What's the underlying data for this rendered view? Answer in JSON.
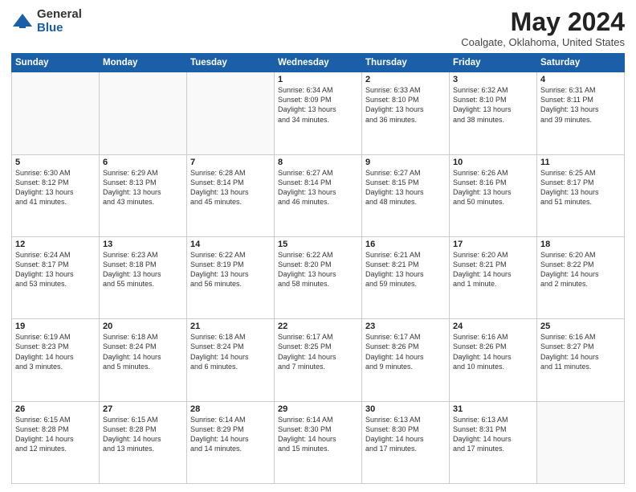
{
  "header": {
    "logo_general": "General",
    "logo_blue": "Blue",
    "title": "May 2024",
    "location": "Coalgate, Oklahoma, United States"
  },
  "days_of_week": [
    "Sunday",
    "Monday",
    "Tuesday",
    "Wednesday",
    "Thursday",
    "Friday",
    "Saturday"
  ],
  "weeks": [
    [
      {
        "day": "",
        "info": ""
      },
      {
        "day": "",
        "info": ""
      },
      {
        "day": "",
        "info": ""
      },
      {
        "day": "1",
        "info": "Sunrise: 6:34 AM\nSunset: 8:09 PM\nDaylight: 13 hours\nand 34 minutes."
      },
      {
        "day": "2",
        "info": "Sunrise: 6:33 AM\nSunset: 8:10 PM\nDaylight: 13 hours\nand 36 minutes."
      },
      {
        "day": "3",
        "info": "Sunrise: 6:32 AM\nSunset: 8:10 PM\nDaylight: 13 hours\nand 38 minutes."
      },
      {
        "day": "4",
        "info": "Sunrise: 6:31 AM\nSunset: 8:11 PM\nDaylight: 13 hours\nand 39 minutes."
      }
    ],
    [
      {
        "day": "5",
        "info": "Sunrise: 6:30 AM\nSunset: 8:12 PM\nDaylight: 13 hours\nand 41 minutes."
      },
      {
        "day": "6",
        "info": "Sunrise: 6:29 AM\nSunset: 8:13 PM\nDaylight: 13 hours\nand 43 minutes."
      },
      {
        "day": "7",
        "info": "Sunrise: 6:28 AM\nSunset: 8:14 PM\nDaylight: 13 hours\nand 45 minutes."
      },
      {
        "day": "8",
        "info": "Sunrise: 6:27 AM\nSunset: 8:14 PM\nDaylight: 13 hours\nand 46 minutes."
      },
      {
        "day": "9",
        "info": "Sunrise: 6:27 AM\nSunset: 8:15 PM\nDaylight: 13 hours\nand 48 minutes."
      },
      {
        "day": "10",
        "info": "Sunrise: 6:26 AM\nSunset: 8:16 PM\nDaylight: 13 hours\nand 50 minutes."
      },
      {
        "day": "11",
        "info": "Sunrise: 6:25 AM\nSunset: 8:17 PM\nDaylight: 13 hours\nand 51 minutes."
      }
    ],
    [
      {
        "day": "12",
        "info": "Sunrise: 6:24 AM\nSunset: 8:17 PM\nDaylight: 13 hours\nand 53 minutes."
      },
      {
        "day": "13",
        "info": "Sunrise: 6:23 AM\nSunset: 8:18 PM\nDaylight: 13 hours\nand 55 minutes."
      },
      {
        "day": "14",
        "info": "Sunrise: 6:22 AM\nSunset: 8:19 PM\nDaylight: 13 hours\nand 56 minutes."
      },
      {
        "day": "15",
        "info": "Sunrise: 6:22 AM\nSunset: 8:20 PM\nDaylight: 13 hours\nand 58 minutes."
      },
      {
        "day": "16",
        "info": "Sunrise: 6:21 AM\nSunset: 8:21 PM\nDaylight: 13 hours\nand 59 minutes."
      },
      {
        "day": "17",
        "info": "Sunrise: 6:20 AM\nSunset: 8:21 PM\nDaylight: 14 hours\nand 1 minute."
      },
      {
        "day": "18",
        "info": "Sunrise: 6:20 AM\nSunset: 8:22 PM\nDaylight: 14 hours\nand 2 minutes."
      }
    ],
    [
      {
        "day": "19",
        "info": "Sunrise: 6:19 AM\nSunset: 8:23 PM\nDaylight: 14 hours\nand 3 minutes."
      },
      {
        "day": "20",
        "info": "Sunrise: 6:18 AM\nSunset: 8:24 PM\nDaylight: 14 hours\nand 5 minutes."
      },
      {
        "day": "21",
        "info": "Sunrise: 6:18 AM\nSunset: 8:24 PM\nDaylight: 14 hours\nand 6 minutes."
      },
      {
        "day": "22",
        "info": "Sunrise: 6:17 AM\nSunset: 8:25 PM\nDaylight: 14 hours\nand 7 minutes."
      },
      {
        "day": "23",
        "info": "Sunrise: 6:17 AM\nSunset: 8:26 PM\nDaylight: 14 hours\nand 9 minutes."
      },
      {
        "day": "24",
        "info": "Sunrise: 6:16 AM\nSunset: 8:26 PM\nDaylight: 14 hours\nand 10 minutes."
      },
      {
        "day": "25",
        "info": "Sunrise: 6:16 AM\nSunset: 8:27 PM\nDaylight: 14 hours\nand 11 minutes."
      }
    ],
    [
      {
        "day": "26",
        "info": "Sunrise: 6:15 AM\nSunset: 8:28 PM\nDaylight: 14 hours\nand 12 minutes."
      },
      {
        "day": "27",
        "info": "Sunrise: 6:15 AM\nSunset: 8:28 PM\nDaylight: 14 hours\nand 13 minutes."
      },
      {
        "day": "28",
        "info": "Sunrise: 6:14 AM\nSunset: 8:29 PM\nDaylight: 14 hours\nand 14 minutes."
      },
      {
        "day": "29",
        "info": "Sunrise: 6:14 AM\nSunset: 8:30 PM\nDaylight: 14 hours\nand 15 minutes."
      },
      {
        "day": "30",
        "info": "Sunrise: 6:13 AM\nSunset: 8:30 PM\nDaylight: 14 hours\nand 17 minutes."
      },
      {
        "day": "31",
        "info": "Sunrise: 6:13 AM\nSunset: 8:31 PM\nDaylight: 14 hours\nand 17 minutes."
      },
      {
        "day": "",
        "info": ""
      }
    ]
  ]
}
